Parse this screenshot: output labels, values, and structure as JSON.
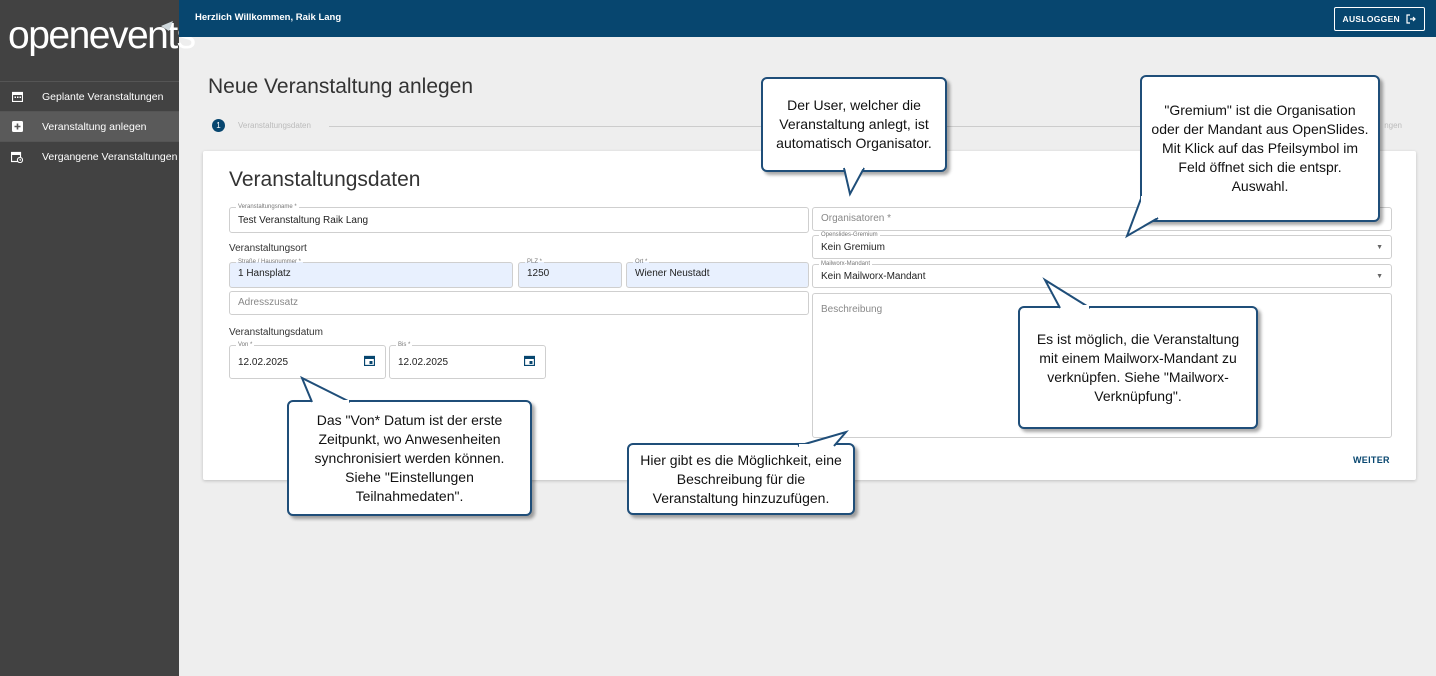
{
  "sidebar": {
    "logo": "openevents",
    "items": [
      {
        "label": "Geplante Veranstaltungen",
        "icon": "calendar-icon"
      },
      {
        "label": "Veranstaltung anlegen",
        "icon": "add-box-icon",
        "active": true
      },
      {
        "label": "Vergangene Veranstaltungen",
        "icon": "calendar-past-icon"
      }
    ]
  },
  "header": {
    "welcome": "Herzlich Willkommen, Raik Lang",
    "logout_label": "AUSLOGGEN"
  },
  "main": {
    "title": "Neue Veranstaltung anlegen",
    "stepper": {
      "step_number": "1",
      "step_label": "Veranstaltungsdaten",
      "next_step_fragment": "ngen"
    },
    "card_title": "Veranstaltungsdaten",
    "form": {
      "event_name": {
        "label": "Veranstaltungsname *",
        "value": "Test Veranstaltung Raik Lang"
      },
      "location_section": "Veranstaltungsort",
      "street": {
        "label": "Straße / Hausnummer *",
        "value": "1 Hansplatz"
      },
      "zip": {
        "label": "PLZ *",
        "value": "1250"
      },
      "city": {
        "label": "Ort *",
        "value": "Wiener Neustadt"
      },
      "address_extra": {
        "placeholder": "Adresszusatz"
      },
      "date_section": "Veranstaltungsdatum",
      "from": {
        "label": "Von *",
        "value": "12.02.2025"
      },
      "to": {
        "label": "Bis *",
        "value": "12.02.2025"
      },
      "organizers": {
        "placeholder": "Organisatoren *"
      },
      "gremium": {
        "label": "Openslides-Gremium",
        "value": "Kein Gremium"
      },
      "mailworx": {
        "label": "Mailworx-Mandant",
        "value": "Kein Mailworx-Mandant"
      },
      "description": {
        "placeholder": "Beschreibung"
      }
    },
    "next_label": "WEITER"
  },
  "callouts": {
    "organizer": "Der User, welcher die Veranstaltung anlegt, ist automatisch Organisator.",
    "gremium": "\"Gremium\" ist die Organisation oder der Mandant aus OpenSlides. Mit Klick auf das Pfeilsymbol im Feld öffnet sich die entspr. Auswahl.",
    "mailworx": "Es ist möglich, die Veranstaltung mit einem Mailworx-Mandant zu verknüpfen. Siehe \"Mailworx-Verknüpfung\".",
    "from_date": "Das \"Von* Datum ist der erste Zeitpunkt, wo Anwesenheiten synchronisiert werden können. Siehe \"Einstellungen Teilnahmedaten\".",
    "description": "Hier gibt es die Möglichkeit, eine Beschreibung für die Veranstaltung hinzuzufügen."
  },
  "colors": {
    "primary": "#07466f",
    "sidebar": "#424242",
    "callout_border": "#1f4e79"
  }
}
